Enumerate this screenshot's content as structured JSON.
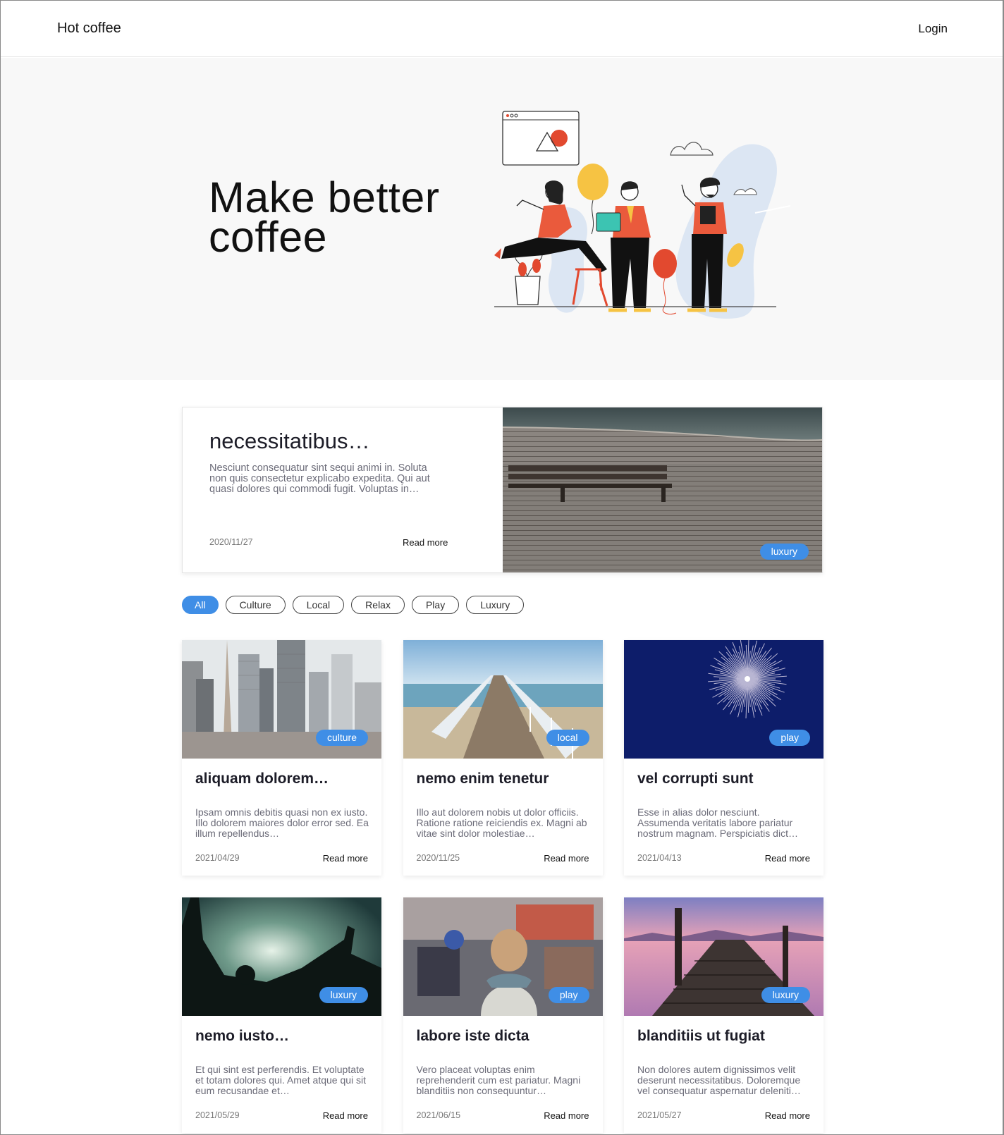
{
  "header": {
    "brand": "Hot coffee",
    "login": "Login"
  },
  "hero": {
    "title_line1": "Make better",
    "title_line2": "coffee"
  },
  "featured": {
    "title": "necessitatibus…",
    "description": "Nesciunt consequatur sint sequi animi in. Soluta non quis consectetur explicabo expedita. Qui aut quasi dolores qui commodi fugit. Voluptas in…",
    "date": "2020/11/27",
    "read_more": "Read more",
    "tag": "luxury"
  },
  "filters": [
    "All",
    "Culture",
    "Local",
    "Relax",
    "Play",
    "Luxury"
  ],
  "cards": [
    {
      "tag": "culture",
      "title": "aliquam dolorem…",
      "description": "Ipsam omnis debitis quasi non ex iusto. Illo dolorem maiores dolor error sed. Ea illum repellendus…",
      "date": "2021/04/29",
      "read_more": "Read more"
    },
    {
      "tag": "local",
      "title": "nemo enim tenetur",
      "description": "Illo aut dolorem nobis ut dolor officiis. Ratione ratione reiciendis ex. Magni ab vitae sint dolor molestiae…",
      "date": "2020/11/25",
      "read_more": "Read more"
    },
    {
      "tag": "play",
      "title": "vel corrupti sunt",
      "description": "Esse in alias dolor nesciunt. Assumenda veritatis labore pariatur nostrum magnam. Perspiciatis dict…",
      "date": "2021/04/13",
      "read_more": "Read more"
    },
    {
      "tag": "luxury",
      "title": "nemo iusto…",
      "description": "Et qui sint est perferendis. Et voluptate et totam dolores qui. Amet atque qui sit eum recusandae et…",
      "date": "2021/05/29",
      "read_more": "Read more"
    },
    {
      "tag": "play",
      "title": "labore iste dicta",
      "description": "Vero placeat voluptas enim reprehenderit cum est pariatur. Magni blanditiis non consequuntur…",
      "date": "2021/06/15",
      "read_more": "Read more"
    },
    {
      "tag": "luxury",
      "title": "blanditiis ut fugiat",
      "description": "Non dolores autem dignissimos velit deserunt necessitatibus. Doloremque vel consequatur aspernatur deleniti…",
      "date": "2021/05/27",
      "read_more": "Read more"
    }
  ],
  "colors": {
    "accent": "#3f8ee6",
    "hero_bg": "#f8f8f8"
  }
}
